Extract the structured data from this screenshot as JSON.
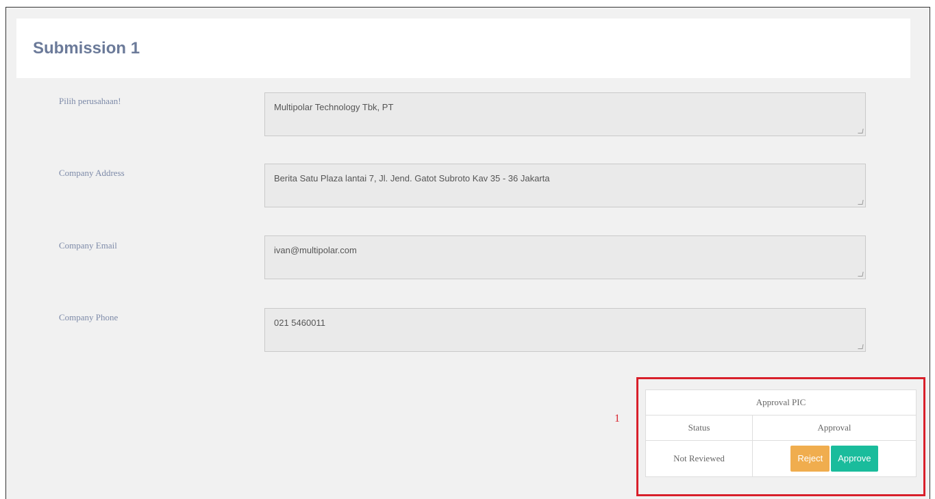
{
  "header": {
    "title": "Submission 1"
  },
  "fields": [
    {
      "label": "Pilih perusahaan!",
      "value": "Multipolar Technology Tbk, PT"
    },
    {
      "label": "Company Address",
      "value": "Berita Satu Plaza lantai 7, Jl. Jend. Gatot Subroto Kav 35 - 36 Jakarta"
    },
    {
      "label": "Company Email",
      "value": "ivan@multipolar.com"
    },
    {
      "label": "Company Phone",
      "value": "021 5460011"
    }
  ],
  "annotation": {
    "number": "1",
    "color": "#d81f2a"
  },
  "approval_table": {
    "title": "Approval PIC",
    "headers": [
      "Status",
      "Approval"
    ],
    "status_value": "Not Reviewed",
    "reject_label": "Reject",
    "approve_label": "Approve"
  },
  "colors": {
    "title": "#6b7a99",
    "reject": "#f0ad4e",
    "approve": "#1abc9c"
  }
}
